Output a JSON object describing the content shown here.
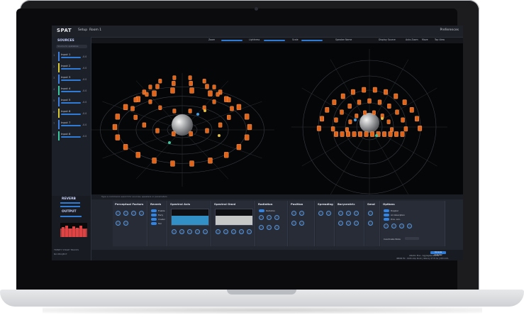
{
  "app": {
    "logo": "SPAT",
    "menu": [
      "Setup",
      "Room 1"
    ],
    "preferences": "Preferences"
  },
  "sources": {
    "title": "SOURCES",
    "filter_placeholder": "Source to spatialize",
    "items": [
      {
        "num": "1",
        "name": "Input 1",
        "value": "-0.0",
        "color": "#3c7fe0",
        "level": 0.6
      },
      {
        "num": "2",
        "name": "Input 2",
        "value": "-0.0",
        "color": "#d8c838",
        "level": 0.6
      },
      {
        "num": "3",
        "name": "Input 3",
        "value": "-0.0",
        "color": "#3c7fe0",
        "level": 0.6
      },
      {
        "num": "4",
        "name": "Input 4",
        "value": "-0.0",
        "color": "#3cc7a0",
        "level": 0.6
      },
      {
        "num": "5",
        "name": "Input 5",
        "value": "-0.0",
        "color": "#3c7fe0",
        "level": 0.6
      },
      {
        "num": "6",
        "name": "Input 6",
        "value": "-0.0",
        "color": "#d8c838",
        "level": 0.6
      },
      {
        "num": "7",
        "name": "Input 7",
        "value": "-0.0",
        "color": "#3c7fe0",
        "level": 0.6
      },
      {
        "num": "8",
        "name": "Input 8",
        "value": "-0.0",
        "color": "#3cc7a0",
        "level": 0.6
      }
    ]
  },
  "reverb": {
    "title": "REVERB"
  },
  "output": {
    "title": "OUTPUT"
  },
  "left_status": [
    "TRINITY STAGE TRACKS",
    "NO PROJECT"
  ],
  "viewer_bar": {
    "left_items": [
      "Zoom",
      "Lightness",
      "Scale"
    ],
    "right_items": [
      "Speaker Name",
      "Display Source",
      "Auto Zoom",
      "Move",
      "Top View"
    ]
  },
  "command_bar": {
    "placeholder": "Type a command, search for sources, speakers or parameters"
  },
  "sections": [
    {
      "title": "Perceptual Factors",
      "knobs": 6
    },
    {
      "title": "Reverb",
      "toggles": [
        "Enable",
        "Early",
        "Cluster",
        "Tail"
      ]
    },
    {
      "title": "Spectral Axis"
    },
    {
      "title": "Spectral Omni"
    },
    {
      "title": "Radiation",
      "toggles": [
        "Radiation"
      ],
      "knobs": 6
    },
    {
      "title": "Position",
      "knobs": 4
    },
    {
      "title": "Spreading",
      "knobs": 2
    },
    {
      "title": "Barycentric",
      "knobs": 6
    },
    {
      "title": "Send",
      "knobs": 2
    },
    {
      "title": "Options",
      "toggles": [
        "Doppler",
        "Air Absorption",
        "Prox. Lim."
      ],
      "knobs": 4,
      "extra_label": "Coordinate Mode"
    }
  ],
  "status": {
    "button": "Console Analyzer",
    "lines": [
      "Ableton Plus - Aggregate Device",
      "48000 Hz - 1024 smp block | latency 27.8 ms | CPU 41%"
    ]
  },
  "colors": {
    "accent": "#2f7bd6",
    "speaker": "#e2641a",
    "background": "#050607"
  }
}
